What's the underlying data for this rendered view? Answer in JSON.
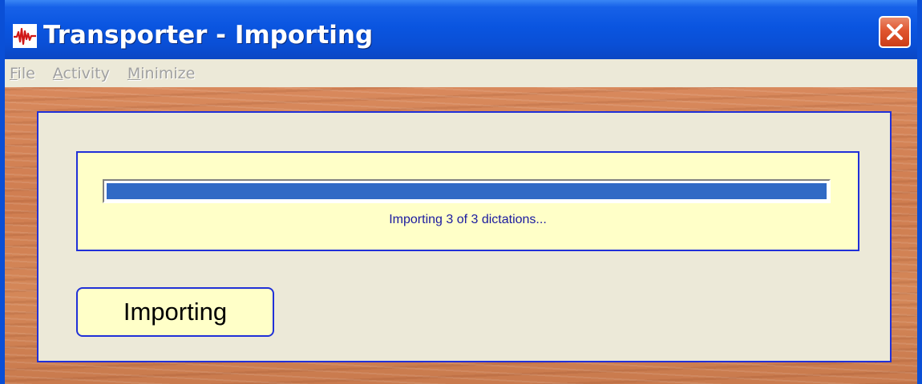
{
  "window": {
    "title": "Transporter - Importing",
    "app_icon": "waveform-icon",
    "close_icon": "close-icon"
  },
  "menu": {
    "items": [
      {
        "mnemonic": "F",
        "rest": "ile"
      },
      {
        "mnemonic": "A",
        "rest": "ctivity"
      },
      {
        "mnemonic": "M",
        "rest": "inimize"
      }
    ],
    "enabled": false
  },
  "progress": {
    "fraction": 1.0,
    "status_text": "Importing 3 of 3 dictations..."
  },
  "status_button": {
    "label": "Importing"
  },
  "colors": {
    "titlebar": "#0a4fd6",
    "close_button": "#e0562f",
    "progress_fill": "#316ac5",
    "panel_border": "#2030d8",
    "highlight_background": "#ffffc8",
    "panel_background": "#ece9d8",
    "client_background": "#d8895c",
    "status_text": "#1a1aa0"
  }
}
